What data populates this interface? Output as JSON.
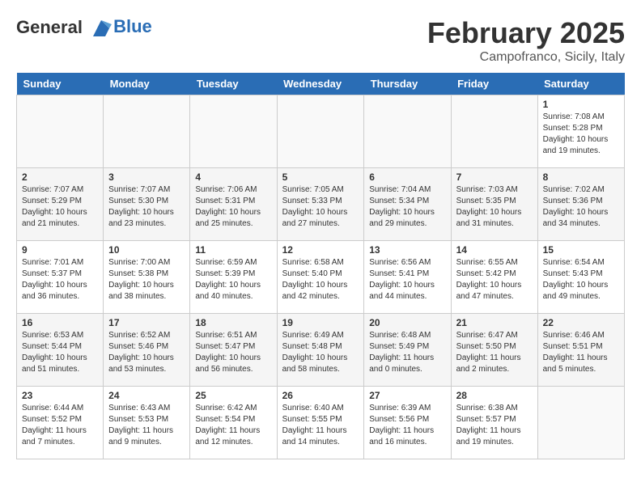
{
  "header": {
    "logo_line1": "General",
    "logo_line2": "Blue",
    "month": "February 2025",
    "location": "Campofranco, Sicily, Italy"
  },
  "weekdays": [
    "Sunday",
    "Monday",
    "Tuesday",
    "Wednesday",
    "Thursday",
    "Friday",
    "Saturday"
  ],
  "weeks": [
    [
      {
        "day": "",
        "info": ""
      },
      {
        "day": "",
        "info": ""
      },
      {
        "day": "",
        "info": ""
      },
      {
        "day": "",
        "info": ""
      },
      {
        "day": "",
        "info": ""
      },
      {
        "day": "",
        "info": ""
      },
      {
        "day": "1",
        "info": "Sunrise: 7:08 AM\nSunset: 5:28 PM\nDaylight: 10 hours\nand 19 minutes."
      }
    ],
    [
      {
        "day": "2",
        "info": "Sunrise: 7:07 AM\nSunset: 5:29 PM\nDaylight: 10 hours\nand 21 minutes."
      },
      {
        "day": "3",
        "info": "Sunrise: 7:07 AM\nSunset: 5:30 PM\nDaylight: 10 hours\nand 23 minutes."
      },
      {
        "day": "4",
        "info": "Sunrise: 7:06 AM\nSunset: 5:31 PM\nDaylight: 10 hours\nand 25 minutes."
      },
      {
        "day": "5",
        "info": "Sunrise: 7:05 AM\nSunset: 5:33 PM\nDaylight: 10 hours\nand 27 minutes."
      },
      {
        "day": "6",
        "info": "Sunrise: 7:04 AM\nSunset: 5:34 PM\nDaylight: 10 hours\nand 29 minutes."
      },
      {
        "day": "7",
        "info": "Sunrise: 7:03 AM\nSunset: 5:35 PM\nDaylight: 10 hours\nand 31 minutes."
      },
      {
        "day": "8",
        "info": "Sunrise: 7:02 AM\nSunset: 5:36 PM\nDaylight: 10 hours\nand 34 minutes."
      }
    ],
    [
      {
        "day": "9",
        "info": "Sunrise: 7:01 AM\nSunset: 5:37 PM\nDaylight: 10 hours\nand 36 minutes."
      },
      {
        "day": "10",
        "info": "Sunrise: 7:00 AM\nSunset: 5:38 PM\nDaylight: 10 hours\nand 38 minutes."
      },
      {
        "day": "11",
        "info": "Sunrise: 6:59 AM\nSunset: 5:39 PM\nDaylight: 10 hours\nand 40 minutes."
      },
      {
        "day": "12",
        "info": "Sunrise: 6:58 AM\nSunset: 5:40 PM\nDaylight: 10 hours\nand 42 minutes."
      },
      {
        "day": "13",
        "info": "Sunrise: 6:56 AM\nSunset: 5:41 PM\nDaylight: 10 hours\nand 44 minutes."
      },
      {
        "day": "14",
        "info": "Sunrise: 6:55 AM\nSunset: 5:42 PM\nDaylight: 10 hours\nand 47 minutes."
      },
      {
        "day": "15",
        "info": "Sunrise: 6:54 AM\nSunset: 5:43 PM\nDaylight: 10 hours\nand 49 minutes."
      }
    ],
    [
      {
        "day": "16",
        "info": "Sunrise: 6:53 AM\nSunset: 5:44 PM\nDaylight: 10 hours\nand 51 minutes."
      },
      {
        "day": "17",
        "info": "Sunrise: 6:52 AM\nSunset: 5:46 PM\nDaylight: 10 hours\nand 53 minutes."
      },
      {
        "day": "18",
        "info": "Sunrise: 6:51 AM\nSunset: 5:47 PM\nDaylight: 10 hours\nand 56 minutes."
      },
      {
        "day": "19",
        "info": "Sunrise: 6:49 AM\nSunset: 5:48 PM\nDaylight: 10 hours\nand 58 minutes."
      },
      {
        "day": "20",
        "info": "Sunrise: 6:48 AM\nSunset: 5:49 PM\nDaylight: 11 hours\nand 0 minutes."
      },
      {
        "day": "21",
        "info": "Sunrise: 6:47 AM\nSunset: 5:50 PM\nDaylight: 11 hours\nand 2 minutes."
      },
      {
        "day": "22",
        "info": "Sunrise: 6:46 AM\nSunset: 5:51 PM\nDaylight: 11 hours\nand 5 minutes."
      }
    ],
    [
      {
        "day": "23",
        "info": "Sunrise: 6:44 AM\nSunset: 5:52 PM\nDaylight: 11 hours\nand 7 minutes."
      },
      {
        "day": "24",
        "info": "Sunrise: 6:43 AM\nSunset: 5:53 PM\nDaylight: 11 hours\nand 9 minutes."
      },
      {
        "day": "25",
        "info": "Sunrise: 6:42 AM\nSunset: 5:54 PM\nDaylight: 11 hours\nand 12 minutes."
      },
      {
        "day": "26",
        "info": "Sunrise: 6:40 AM\nSunset: 5:55 PM\nDaylight: 11 hours\nand 14 minutes."
      },
      {
        "day": "27",
        "info": "Sunrise: 6:39 AM\nSunset: 5:56 PM\nDaylight: 11 hours\nand 16 minutes."
      },
      {
        "day": "28",
        "info": "Sunrise: 6:38 AM\nSunset: 5:57 PM\nDaylight: 11 hours\nand 19 minutes."
      },
      {
        "day": "",
        "info": ""
      }
    ]
  ]
}
